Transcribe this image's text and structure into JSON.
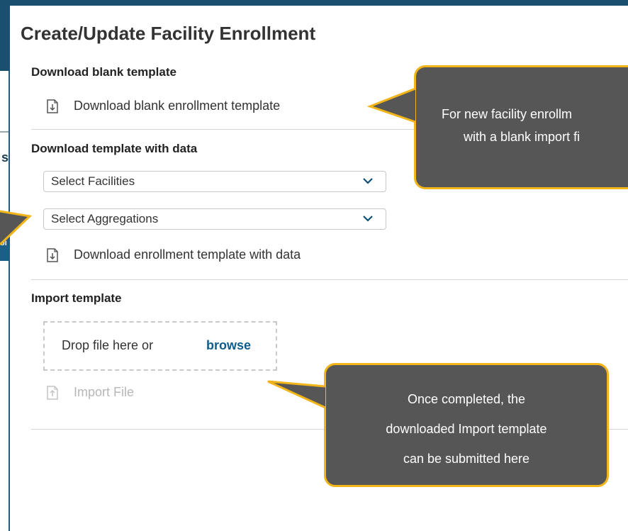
{
  "dialog": {
    "title": "Create/Update Facility Enrollment",
    "sections": {
      "blank": {
        "title": "Download blank template",
        "link_label": "Download blank enrollment template"
      },
      "with_data": {
        "title": "Download template with data",
        "facilities_select": "Select Facilities",
        "aggregations_select": "Select Aggregations",
        "link_label": "Download enrollment template with data"
      },
      "import": {
        "title": "Import template",
        "drop_text": "Drop file here or",
        "browse_label": "browse",
        "import_button": "Import File"
      }
    }
  },
  "background": {
    "panel_letter": "s",
    "panel_button": "oi"
  },
  "callouts": {
    "new_facility": {
      "line1": "For new  facility enrollm",
      "line2": "with a blank  import fi"
    },
    "import": {
      "line1": "Once completed, the",
      "line2": "downloaded  Import template",
      "line3": "can be submitted here"
    }
  },
  "colors": {
    "background_blue": "#1d5e7e",
    "callout_fill": "#565656",
    "callout_border": "#f1b51a",
    "browse_link": "#0e5d8a"
  },
  "icons": [
    "download-file-icon",
    "chevron-down-icon",
    "upload-file-icon"
  ]
}
